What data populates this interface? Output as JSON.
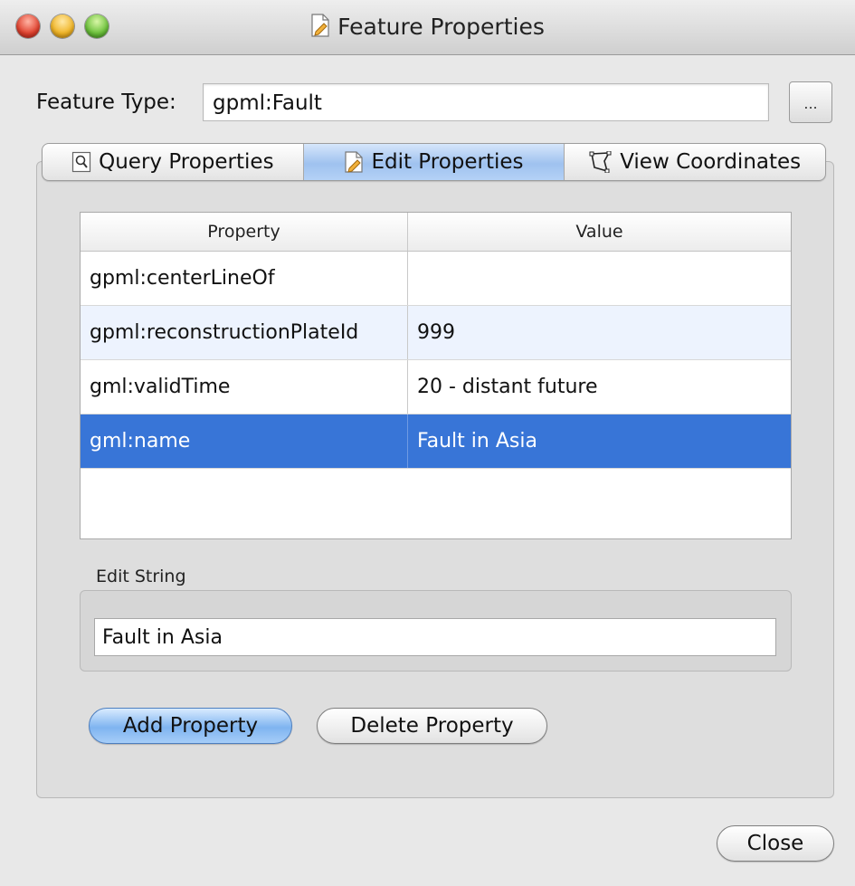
{
  "window": {
    "title": "Feature Properties",
    "title_icon": "edit-document-icon"
  },
  "feature_type": {
    "label": "Feature Type:",
    "value": "gpml:Fault",
    "browse_label": "..."
  },
  "tabs": [
    {
      "label": "Query Properties",
      "icon": "magnifier-document-icon",
      "active": false
    },
    {
      "label": "Edit Properties",
      "icon": "edit-document-icon",
      "active": true
    },
    {
      "label": "View Coordinates",
      "icon": "polygon-icon",
      "active": false
    }
  ],
  "table": {
    "headers": [
      "Property",
      "Value"
    ],
    "rows": [
      {
        "property": "gpml:centerLineOf",
        "value": ""
      },
      {
        "property": "gpml:reconstructionPlateId",
        "value": "999"
      },
      {
        "property": "gml:validTime",
        "value": "20 - distant future"
      },
      {
        "property": "gml:name",
        "value": "Fault in Asia",
        "selected": true
      }
    ]
  },
  "edit": {
    "group_label": "Edit String",
    "value": "Fault in Asia"
  },
  "buttons": {
    "add": "Add Property",
    "delete": "Delete Property",
    "close": "Close"
  },
  "colors": {
    "selection": "#3875d7",
    "alt_row": "#edf3fe",
    "active_tab": "#9fc2ef"
  }
}
